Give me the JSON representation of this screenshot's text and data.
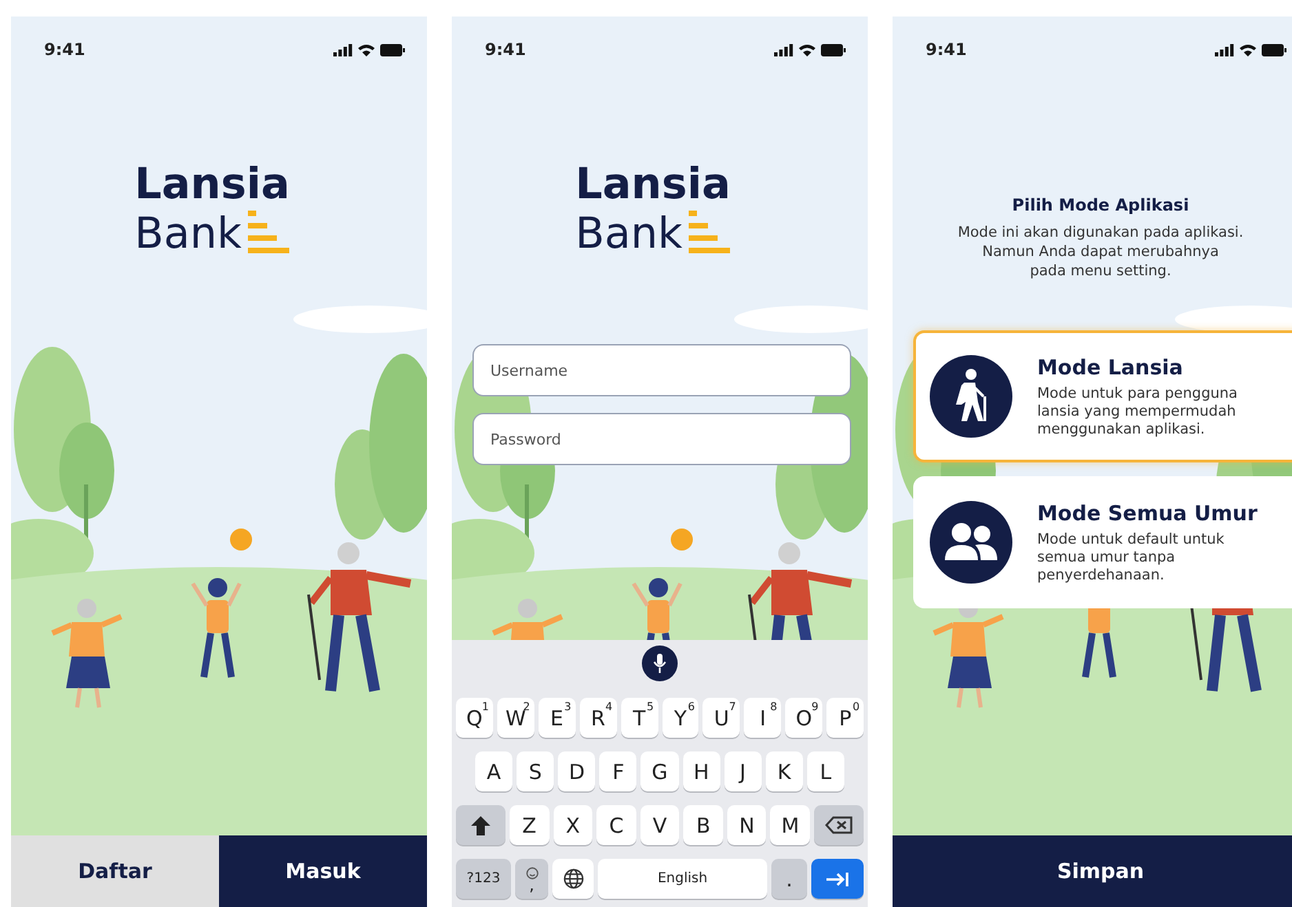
{
  "screens": [
    {
      "kind": "welcome",
      "time": "9:41",
      "logo": {
        "line1": "Lansia",
        "line2": "Bank"
      },
      "buttons": [
        {
          "label": "Daftar",
          "kind": "secondary"
        },
        {
          "label": "Masuk",
          "kind": "primary"
        }
      ]
    },
    {
      "kind": "login",
      "time": "9:41",
      "logo": {
        "line1": "Lansia",
        "line2": "Bank"
      },
      "fields": [
        {
          "placeholder": "Username"
        },
        {
          "placeholder": "Password"
        }
      ],
      "keyboard": {
        "letter_rows": [
          {
            "keys": [
              {
                "kind": "letter",
                "label": "Q",
                "hint": "1"
              },
              {
                "kind": "letter",
                "label": "W",
                "hint": "2"
              },
              {
                "kind": "letter",
                "label": "E",
                "hint": "3"
              },
              {
                "kind": "letter",
                "label": "R",
                "hint": "4"
              },
              {
                "kind": "letter",
                "label": "T",
                "hint": "5"
              },
              {
                "kind": "letter",
                "label": "Y",
                "hint": "6"
              },
              {
                "kind": "letter",
                "label": "U",
                "hint": "7"
              },
              {
                "kind": "letter",
                "label": "I",
                "hint": "8"
              },
              {
                "kind": "letter",
                "label": "O",
                "hint": "9"
              },
              {
                "kind": "letter",
                "label": "P",
                "hint": "0"
              }
            ]
          },
          {
            "keys": [
              {
                "kind": "letter",
                "label": "A"
              },
              {
                "kind": "letter",
                "label": "S"
              },
              {
                "kind": "letter",
                "label": "D"
              },
              {
                "kind": "letter",
                "label": "F"
              },
              {
                "kind": "letter",
                "label": "G"
              },
              {
                "kind": "letter",
                "label": "H"
              },
              {
                "kind": "letter",
                "label": "J"
              },
              {
                "kind": "letter",
                "label": "K"
              },
              {
                "kind": "letter",
                "label": "L"
              }
            ]
          },
          {
            "keys": [
              {
                "kind": "shift"
              },
              {
                "kind": "letter",
                "label": "Z"
              },
              {
                "kind": "letter",
                "label": "X"
              },
              {
                "kind": "letter",
                "label": "C"
              },
              {
                "kind": "letter",
                "label": "V"
              },
              {
                "kind": "letter",
                "label": "B"
              },
              {
                "kind": "letter",
                "label": "N"
              },
              {
                "kind": "letter",
                "label": "M"
              },
              {
                "kind": "backspace"
              }
            ]
          }
        ],
        "bottom_row": [
          {
            "kind": "symbols",
            "label": "?123"
          },
          {
            "kind": "emoji",
            "label": ","
          },
          {
            "kind": "globe"
          },
          {
            "kind": "space",
            "label": "English"
          },
          {
            "kind": "period",
            "label": "."
          },
          {
            "kind": "enter"
          }
        ]
      }
    },
    {
      "kind": "mode",
      "time": "9:41",
      "title": "Pilih Mode Aplikasi",
      "description": "Mode ini akan digunakan pada aplikasi.\nNamun Anda dapat merubahnya\npada menu setting.",
      "modes": [
        {
          "kind": "walker",
          "title": "Mode Lansia",
          "description": "Mode untuk para pengguna lansia yang mempermudah menggunakan aplikasi.",
          "selected": true
        },
        {
          "kind": "people",
          "title": "Mode Semua Umur",
          "description": "Mode untuk default untuk semua umur tanpa penyerdehanaan.",
          "selected": false
        }
      ],
      "buttons": [
        {
          "label": "Simpan",
          "kind": "primary"
        }
      ]
    }
  ]
}
